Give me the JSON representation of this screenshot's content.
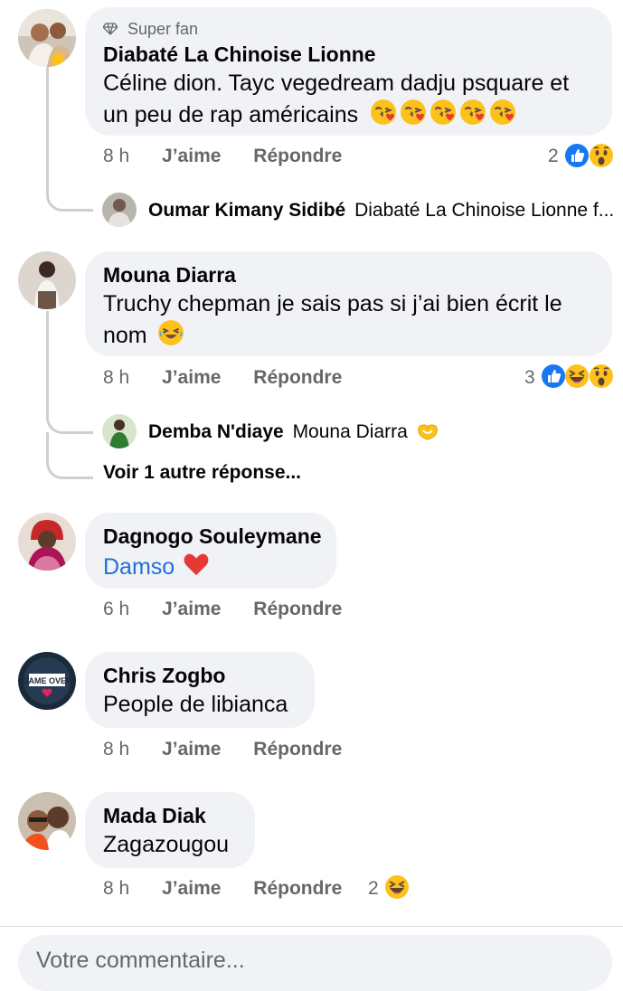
{
  "comments": [
    {
      "badge_icon": "diamond-icon",
      "badge": "Super fan",
      "author": "Diabaté La Chinoise Lionne",
      "text_line1": "Céline dion. Tayc vegedream dadju psquare et",
      "text_line2": "un peu de rap américains",
      "text_emojis": [
        "face-blowing-kiss",
        "face-blowing-kiss",
        "face-blowing-kiss",
        "face-blowing-kiss",
        "face-blowing-kiss"
      ],
      "time": "8 h",
      "like": "J’aime",
      "reply": "Répondre",
      "reaction_count": "2",
      "reactions": [
        "like",
        "wow"
      ],
      "replies": [
        {
          "author": "Oumar Kimany Sidibé",
          "preview": "Diabaté La Chinoise Lionne f..."
        }
      ]
    },
    {
      "author": "Mouna Diarra",
      "text_line1": "Truchy chepman je sais pas si j’ai bien écrit le",
      "text_line2": "nom",
      "text_emojis": [
        "face-tears-of-joy"
      ],
      "time": "8 h",
      "like": "J’aime",
      "reply": "Répondre",
      "reaction_count": "3",
      "reactions": [
        "like",
        "haha",
        "wow"
      ],
      "replies": [
        {
          "author": "Demba N'diaye",
          "preview": "Mouna Diarra",
          "preview_emoji": "heart-hands"
        }
      ],
      "see_more": "Voir 1 autre réponse..."
    },
    {
      "author": "Dagnogo Souleymane",
      "text_link": "Damso",
      "text_emojis": [
        "red-heart"
      ],
      "time": "6 h",
      "like": "J’aime",
      "reply": "Répondre"
    },
    {
      "author": "Chris Zogbo",
      "text_line1": "People de libianca",
      "avatar_text": "GAME OVER",
      "time": "8 h",
      "like": "J’aime",
      "reply": "Répondre"
    },
    {
      "author": "Mada Diak",
      "text_line1": "Zagazougou",
      "time": "8 h",
      "like": "J’aime",
      "reply": "Répondre",
      "reaction_count": "2",
      "reactions": [
        "haha"
      ]
    }
  ],
  "composer": {
    "placeholder": "Votre commentaire..."
  },
  "colors": {
    "bubble": "#f0f2f5",
    "meta": "#65676b",
    "link": "#216fdb",
    "like_blue": "#1877f2",
    "emoji_yellow": "#fbc02d"
  }
}
